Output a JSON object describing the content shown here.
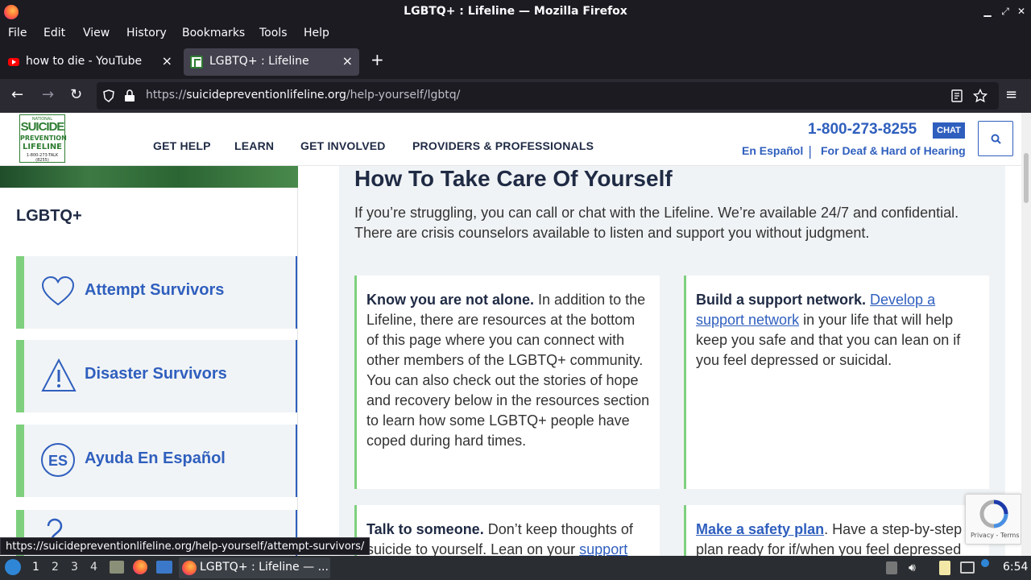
{
  "window": {
    "title": "LGBTQ+ : Lifeline — Mozilla Firefox"
  },
  "menu": [
    "File",
    "Edit",
    "View",
    "History",
    "Bookmarks",
    "Tools",
    "Help"
  ],
  "tabs": [
    {
      "label": "how to die - YouTube",
      "icon": "youtube-icon",
      "active": false
    },
    {
      "label": "LGBTQ+ : Lifeline",
      "icon": "lifeline-icon",
      "active": true
    }
  ],
  "address": {
    "prefix": "https://",
    "domain": "suicidepreventionlifeline.org",
    "path": "/help-yourself/lgbtq/"
  },
  "site": {
    "logo": {
      "line1": "NATIONAL",
      "line2": "SUICIDE",
      "line3": "PREVENTION",
      "line4": "LIFELINE",
      "line5": "1-800-273-TALK (8255)"
    },
    "nav": [
      "GET HELP",
      "LEARN",
      "GET INVOLVED",
      "PROVIDERS & PROFESSIONALS"
    ],
    "phone": "1-800-273-8255",
    "chat": "CHAT",
    "espanol": "En Español",
    "separator": "|",
    "deaf": "For Deaf & Hard of Hearing"
  },
  "sidebar": {
    "title": "LGBTQ+",
    "items": [
      {
        "label": "Attempt Survivors",
        "icon": "heart-icon"
      },
      {
        "label": "Disaster Survivors",
        "icon": "warning-icon"
      },
      {
        "label": "Ayuda En Español",
        "icon": "es-icon"
      }
    ]
  },
  "main": {
    "title": "How To Take Care Of Yourself",
    "intro": "If you’re struggling, you can call or chat with the Lifeline. We’re available 24/7 and confidential. There are crisis counselors available to listen and support you without judgment.",
    "cards": [
      {
        "bold": "Know you are not alone.",
        "text": " In addition to the Lifeline, there are resources at the bottom of this page where you can connect with other members of the LGBTQ+ community. You can also check out the stories of hope and recovery below in the resources section to learn how some LGBTQ+ people have coped during hard times."
      },
      {
        "bold": "Build a support network.",
        "link": "Develop a support network",
        "text": " in your life that will help keep you safe and that you can lean on if you feel depressed or suicidal."
      },
      {
        "bold": "Talk to someone.",
        "text": " Don’t keep thoughts of suicide to yourself. Lean on your ",
        "link": "support"
      },
      {
        "link": "Make a safety plan",
        "text": ". Have a step-by-step plan ready for if/when you feel depressed"
      }
    ]
  },
  "recaptcha": {
    "text": "Privacy - Terms"
  },
  "status_url": "https://suicidepreventionlifeline.org/help-yourself/attempt-survivors/",
  "taskbar": {
    "workspaces": [
      "1",
      "2",
      "3",
      "4"
    ],
    "window_label": "LGBTQ+ : Lifeline — ...",
    "clock": "6:54"
  }
}
